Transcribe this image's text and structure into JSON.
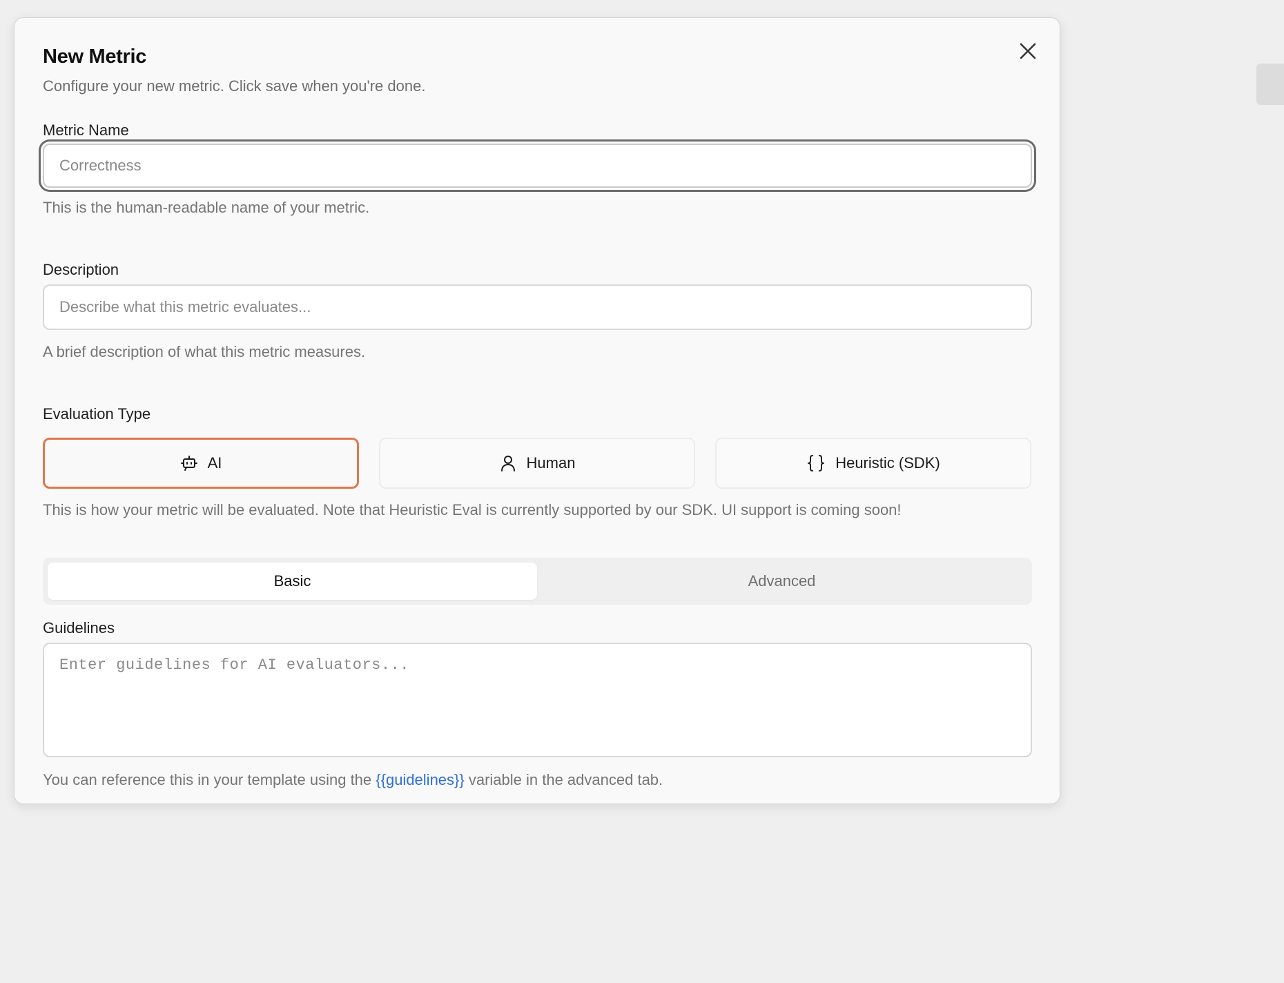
{
  "dialog": {
    "title": "New Metric",
    "subtitle": "Configure your new metric. Click save when you're done.",
    "close_icon": "close-icon"
  },
  "metric_name": {
    "label": "Metric Name",
    "value": "",
    "placeholder": "Correctness",
    "help": "This is the human-readable name of your metric."
  },
  "description": {
    "label": "Description",
    "value": "",
    "placeholder": "Describe what this metric evaluates...",
    "help": "A brief description of what this metric measures."
  },
  "evaluation_type": {
    "label": "Evaluation Type",
    "options": [
      {
        "label": "AI",
        "icon": "bot-icon",
        "selected": true
      },
      {
        "label": "Human",
        "icon": "user-icon",
        "selected": false
      },
      {
        "label": "Heuristic (SDK)",
        "icon": "braces-icon",
        "selected": false
      }
    ],
    "help": "This is how your metric will be evaluated. Note that Heuristic Eval is currently supported by our SDK. UI support is coming soon!"
  },
  "tabs": [
    {
      "label": "Basic",
      "active": true
    },
    {
      "label": "Advanced",
      "active": false
    }
  ],
  "guidelines": {
    "label": "Guidelines",
    "value": "",
    "placeholder": "Enter guidelines for AI evaluators...",
    "help_prefix": "You can reference this in your template using the ",
    "help_variable": "{{guidelines}}",
    "help_suffix": " variable in the advanced tab."
  },
  "colors": {
    "selected_border": "#e2764c",
    "link": "#2f6fd6",
    "focus_ring": "#6b6b6b"
  }
}
